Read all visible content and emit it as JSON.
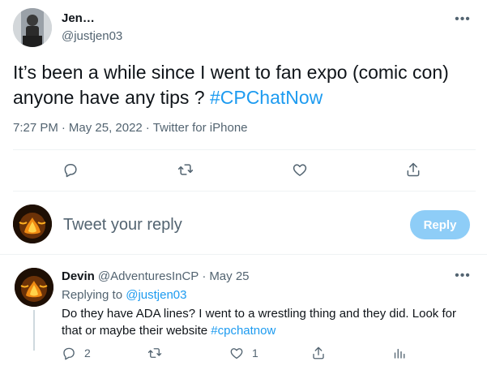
{
  "tweet": {
    "author_name": "Jen…",
    "author_handle": "@justjen03",
    "text_main": "It’s been a while since I went to fan expo (comic con) anyone have any tips ? ",
    "text_hashtag": "#CPChatNow",
    "time": "7:27 PM",
    "sep1": "·",
    "date": "May 25, 2022",
    "sep2": "·",
    "source": "Twitter for iPhone",
    "more_label": "•••"
  },
  "actions": {
    "icons": [
      "reply-icon",
      "retweet-icon",
      "like-icon",
      "share-icon"
    ]
  },
  "composer": {
    "placeholder": "Tweet your reply",
    "button_label": "Reply"
  },
  "reply": {
    "name": "Devin",
    "handle": "@AdventuresInCP",
    "sep": "·",
    "date": "May 25",
    "replying_prefix": "Replying to ",
    "replying_to": "@justjen03",
    "body_text": "Do they have ADA lines? I went to a wrestling thing and they did. Look for that or maybe their website ",
    "body_hashtag": "#cpchatnow",
    "reply_count": "2",
    "like_count": "1",
    "more_label": "•••"
  },
  "colors": {
    "accent": "#1d9bf0",
    "muted": "#536471",
    "reply_button_bg": "#8ecdf7"
  }
}
